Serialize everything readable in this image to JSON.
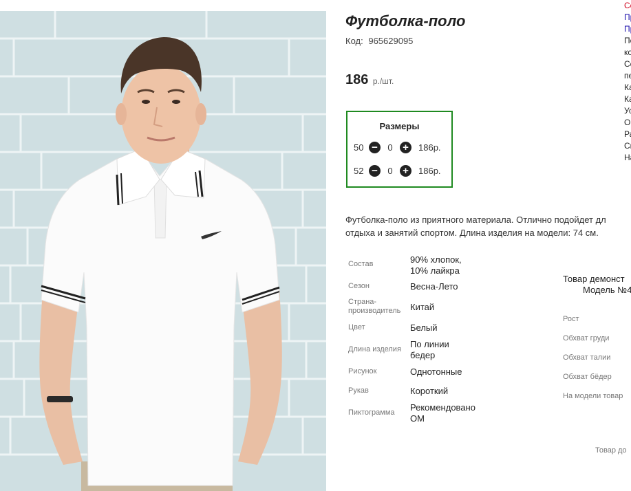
{
  "product": {
    "title": "Футболка-поло",
    "code_label": "Код:",
    "code_value": "965629095",
    "price": "186",
    "price_unit": "р./шт."
  },
  "sizes": {
    "title": "Размеры",
    "rows": [
      {
        "size": "50",
        "qty": "0",
        "price": "186р."
      },
      {
        "size": "52",
        "qty": "0",
        "price": "186р."
      }
    ],
    "minus_symbol": "−",
    "plus_symbol": "+"
  },
  "description": {
    "line1": "Футболка-поло из приятного материала. Отлично подойдет дл",
    "line2": "отдыха и занятий спортом. Длина изделия на модели: 74 см."
  },
  "specs": [
    {
      "label": "Состав",
      "value_lines": [
        "90% хлопок,",
        "10% лайкра"
      ]
    },
    {
      "label": "Сезон",
      "value_lines": [
        "Весна-Лето"
      ]
    },
    {
      "label_lines": [
        "Страна-",
        "производитель"
      ],
      "value_lines": [
        "Китай"
      ]
    },
    {
      "label": "Цвет",
      "value_lines": [
        "Белый"
      ]
    },
    {
      "label": "Длина изделия",
      "value_lines": [
        "По линии",
        "бедер"
      ]
    },
    {
      "label": "Рисунок",
      "value_lines": [
        "Однотонные"
      ]
    },
    {
      "label": "Рукав",
      "value_lines": [
        "Короткий"
      ]
    },
    {
      "label": "Пиктограмма",
      "value_lines": [
        "Рекомендовано",
        "ОМ"
      ]
    }
  ],
  "model": {
    "heading_line1": "Товар демонст",
    "heading_line2": "Модель №4",
    "labels": [
      "Рост",
      "Обхват груди",
      "Обхват талии",
      "Обхват бёдер",
      "На модели товар"
    ],
    "footer": "Товар до"
  },
  "right_menu": [
    "Со",
    "Пр",
    "Пр",
    "По",
    "ко",
    "Се",
    "пе",
    "Ка",
    "Ка",
    "Ус",
    "Оп",
    "Ра",
    "Сп",
    "На"
  ],
  "colors": {
    "sizes_border": "#1f8a20",
    "menu_red": "#d0021b",
    "menu_blue": "#1a0dab"
  }
}
